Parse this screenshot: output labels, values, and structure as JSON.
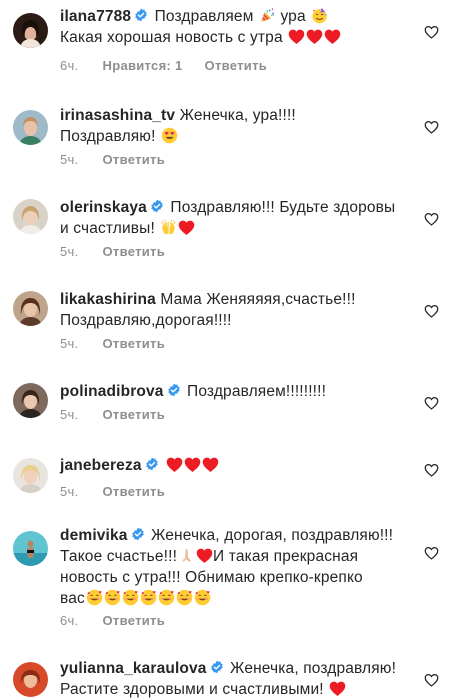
{
  "comments": [
    {
      "username": "ilana7788",
      "verified": true,
      "text": "Поздравляем 🎉 ура 🥳 Какая хорошая новость с утра ❤️❤️❤️",
      "lines": [
        "Поздравляем",
        "ура",
        "Какая хорошая новость с утра"
      ],
      "time": "6ч.",
      "likes": "Нравится: 1",
      "reply": "Ответить"
    },
    {
      "username": "irinasashina_tv",
      "verified": false,
      "text": "Женечка, ура!!!! Поздравляю! 😍",
      "lines": [
        "Женечка, ура!!!!",
        "Поздравляю!"
      ],
      "time": "5ч.",
      "reply": "Ответить"
    },
    {
      "username": "olerinskaya",
      "verified": true,
      "text": "Поздравляю!!! Будьте здоровы и счастливы! 🙌❤️",
      "lines": [
        "Поздравляю!!! Будьте здоровы",
        "и счастливы!"
      ],
      "time": "5ч.",
      "reply": "Ответить"
    },
    {
      "username": "likakashirina",
      "verified": false,
      "text": "Мама Женяяяяя,счастье!!! Поздравляю,дорогая!!!!",
      "lines": [
        "Мама Женяяяяя,счастье!!!",
        "Поздравляю,дорогая!!!!"
      ],
      "time": "5ч.",
      "reply": "Ответить"
    },
    {
      "username": "polinadibrova",
      "verified": true,
      "text": "Поздравляем!!!!!!!!!",
      "lines": [
        "Поздравляем!!!!!!!!!"
      ],
      "time": "5ч.",
      "reply": "Ответить"
    },
    {
      "username": "janebereza",
      "verified": true,
      "text": "❤️❤️❤️",
      "lines": [],
      "time": "5ч.",
      "reply": "Ответить"
    },
    {
      "username": "demivika",
      "verified": true,
      "text": "Женечка, дорогая, поздравляю!!! Такое счастье!!!🙏🏻❤️И такая прекрасная новость с утра!!! Обнимаю крепко-крепко вас🥰🥰🥰🥰🥰🥰🥰",
      "lines": [
        "Женечка, дорогая, поздравляю!!!",
        "Такое счастье!!!",
        "И такая прекрасная",
        "новость с утра!!! Обнимаю крепко-крепко",
        "вас"
      ],
      "time": "6ч.",
      "reply": "Ответить"
    },
    {
      "username": "yulianna_karaulova",
      "verified": true,
      "text": "Женечка, поздравляю! Растите здоровыми и счастливыми! ❤️",
      "lines": [
        "Женечка, поздравляю!",
        "Растите здоровыми и счастливыми!"
      ]
    }
  ],
  "icons": {
    "like": "heart-outline-icon",
    "verified": "verified-badge-icon"
  },
  "colors": {
    "verified": "#3897f0",
    "heart": "#ed4956",
    "meta": "#8e8e8e",
    "text": "#262626"
  }
}
